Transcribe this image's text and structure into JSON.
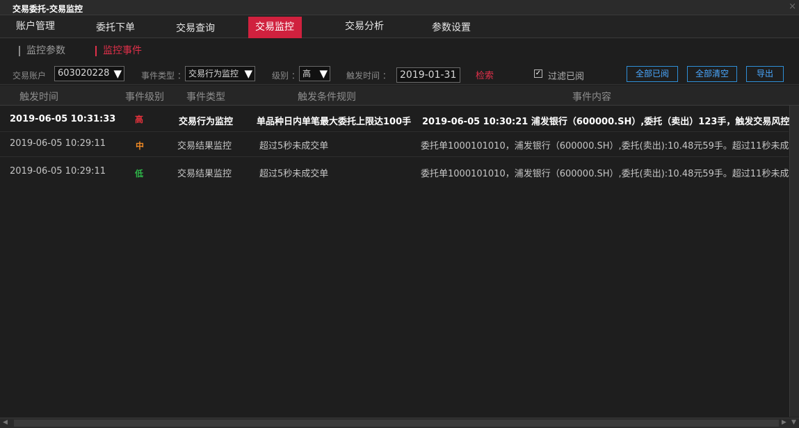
{
  "window": {
    "title": "交易委托-交易监控",
    "close_glyph": "×"
  },
  "menu": [
    {
      "label": "账户管理",
      "active": false
    },
    {
      "label": "委托下单",
      "active": false
    },
    {
      "label": "交易查询",
      "active": false
    },
    {
      "label": "交易监控",
      "active": true
    },
    {
      "label": "交易分析",
      "active": false
    },
    {
      "label": "参数设置",
      "active": false
    }
  ],
  "subtabs": [
    {
      "label": "监控参数",
      "active": false
    },
    {
      "label": "监控事件",
      "active": true
    }
  ],
  "filters": {
    "account_label": "交易账户",
    "account_value": "603020228",
    "event_type_label": "事件类型 ：",
    "event_type_value": "交易行为监控",
    "level_label": "级别 ：",
    "level_value": "高",
    "trigger_time_label": "触发时间 ：",
    "trigger_time_value": "2019-01-31",
    "search_label": "检索",
    "filter_read_label": "过滤已阅",
    "filter_read_checked": "✓",
    "btn_mark_all_read": "全部已阅",
    "btn_clear_all": "全部清空",
    "btn_export": "导出",
    "dropdown_arrow": "▼"
  },
  "table": {
    "headers": [
      "触发时间",
      "事件级别",
      "事件类型",
      "触发条件规则",
      "事件内容"
    ],
    "rows": [
      {
        "time": "2019-06-05 10:31:33",
        "level": "高",
        "level_color": "#e8323c",
        "type": "交易行为监控",
        "rule": "单品种日内单笔最大委托上限达100手",
        "content": "2019-06-05 10:30:21  浦发银行（600000.SH）,委托（卖出）123手，触发交易风控",
        "unread": true
      },
      {
        "time": "2019-06-05 10:29:11",
        "level": "中",
        "level_color": "#f08a24",
        "type": "交易结果监控",
        "rule": "超过5秒未成交单",
        "content": "委托单1000101010，浦发银行（600000.SH）,委托(卖出):10.48元59手。超过11秒未成",
        "unread": false
      },
      {
        "time": "2019-06-05 10:29:11",
        "level": "低",
        "level_color": "#2fb84a",
        "type": "交易结果监控",
        "rule": "超过5秒未成交单",
        "content": "委托单1000101010，浦发银行（600000.SH）,委托(卖出):10.48元59手。超过11秒未成",
        "unread": false
      }
    ]
  },
  "colors": {
    "accent": "#d0213e",
    "link_blue": "#2f8fd8",
    "background": "#1e1e1e"
  }
}
